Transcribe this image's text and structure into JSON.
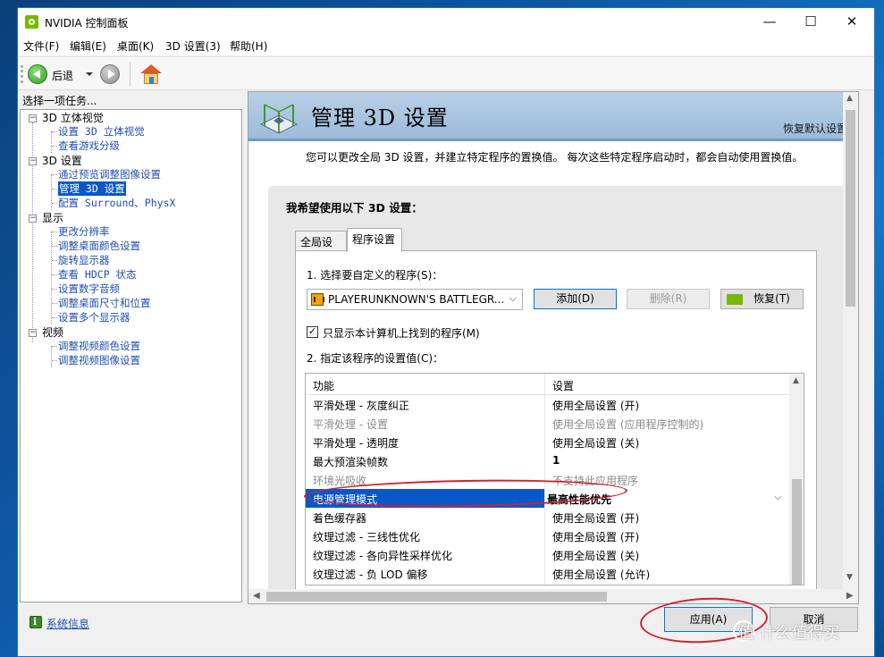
{
  "window": {
    "title": "NVIDIA 控制面板",
    "controls": {
      "minimize": "—",
      "maximize": "☐",
      "close": "✕"
    }
  },
  "menu": [
    "文件(F)",
    "编辑(E)",
    "桌面(K)",
    "3D 设置(3)",
    "帮助(H)"
  ],
  "toolbar": {
    "back_label": "后退"
  },
  "left": {
    "task_label": "选择一项任务...",
    "categories": [
      {
        "label": "3D 立体视觉",
        "items": [
          "设置 3D 立体视觉",
          "查看游戏分级"
        ]
      },
      {
        "label": "3D 设置",
        "items": [
          "通过预览调整图像设置",
          "管理 3D 设置",
          "配置 Surround、PhysX"
        ]
      },
      {
        "label": "显示",
        "items": [
          "更改分辨率",
          "调整桌面颜色设置",
          "旋转显示器",
          "查看 HDCP 状态",
          "设置数字音频",
          "调整桌面尺寸和位置",
          "设置多个显示器"
        ]
      },
      {
        "label": "视频",
        "items": [
          "调整视频颜色设置",
          "调整视频图像设置"
        ]
      }
    ],
    "selected_item": "管理 3D 设置",
    "system_info": "系统信息"
  },
  "main": {
    "title": "管理 3D 设置",
    "restore_defaults": "恢复默认设置",
    "description": "您可以更改全局 3D 设置，并建立特定程序的置换值。 每次这些特定程序启动时，都会自动使用置换值。",
    "heading": "我希望使用以下 3D 设置：",
    "tabs": [
      "全局设置",
      "程序设置"
    ],
    "active_tab": "程序设置",
    "step1_label": "1. 选择要自定义的程序(S)：",
    "program_selected": "PLAYERUNKNOWN'S BATTLEGR...",
    "add_button": "添加(D)",
    "remove_button": "删除(R)",
    "restore_button": "恢复(T)",
    "only_show_label": "只显示本计算机上找到的程序(M)",
    "only_show_checked": true,
    "step2_label": "2. 指定该程序的设置值(C)：",
    "grid": {
      "headers": [
        "功能",
        "设置"
      ],
      "rows": [
        {
          "feature": "平滑处理 - 灰度纠正",
          "value": "使用全局设置 (开)",
          "disabled": false
        },
        {
          "feature": "平滑处理 - 设置",
          "value": "使用全局设置 (应用程序控制的)",
          "disabled": true
        },
        {
          "feature": "平滑处理 - 透明度",
          "value": "使用全局设置 (关)",
          "disabled": false
        },
        {
          "feature": "最大预渲染帧数",
          "value": "1",
          "disabled": false
        },
        {
          "feature": "环境光吸收",
          "value": "不支持此应用程序",
          "disabled": true
        },
        {
          "feature": "电源管理模式",
          "value": "最高性能优先",
          "disabled": false,
          "selected": true
        },
        {
          "feature": "着色缓存器",
          "value": "使用全局设置 (开)",
          "disabled": false
        },
        {
          "feature": "纹理过滤 - 三线性优化",
          "value": "使用全局设置 (开)",
          "disabled": false
        },
        {
          "feature": "纹理过滤 - 各向异性采样优化",
          "value": "使用全局设置 (关)",
          "disabled": false
        },
        {
          "feature": "纹理过滤 - 负 LOD 偏移",
          "value": "使用全局设置 (允许)",
          "disabled": false
        }
      ]
    }
  },
  "footer": {
    "apply": "应用(A)",
    "cancel": "取消"
  },
  "watermark": "值 什么值得买",
  "colors": {
    "selection": "#0a58c8",
    "annotation": "#d42030",
    "nvidia_green": "#76b900",
    "header_band": "#9dbbd9"
  }
}
